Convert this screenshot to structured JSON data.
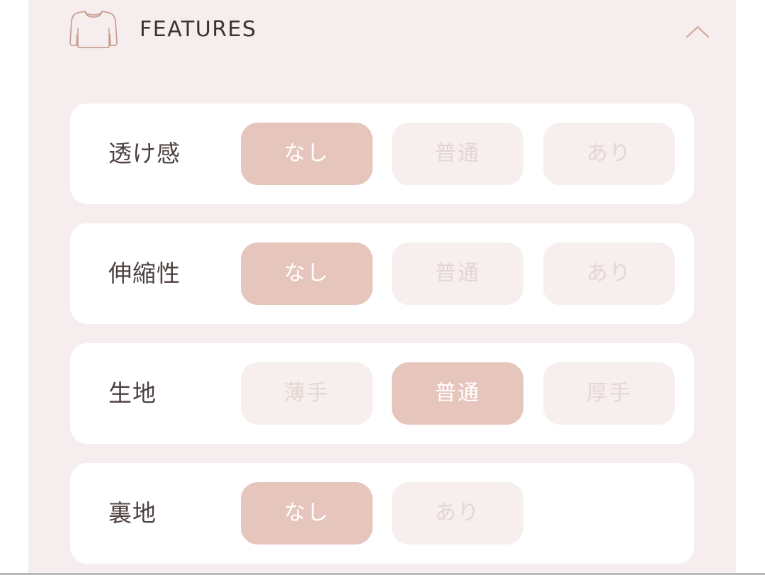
{
  "header": {
    "title": "FEATURES",
    "icon": "shirt-icon",
    "toggle_icon": "chevron-up-icon"
  },
  "colors": {
    "panel_bg": "#f6eeee",
    "selected_bg": "#e6c5bc",
    "unselected_bg": "#f6efee",
    "unselected_text": "#e6d6d3",
    "accent_icon": "#c9a093"
  },
  "features": [
    {
      "label": "透け感",
      "options": [
        "なし",
        "普通",
        "あり"
      ],
      "selected": "なし"
    },
    {
      "label": "伸縮性",
      "options": [
        "なし",
        "普通",
        "あり"
      ],
      "selected": "なし"
    },
    {
      "label": "生地",
      "options": [
        "薄手",
        "普通",
        "厚手"
      ],
      "selected": "普通"
    },
    {
      "label": "裏地",
      "options": [
        "なし",
        "あり"
      ],
      "selected": "なし"
    }
  ]
}
